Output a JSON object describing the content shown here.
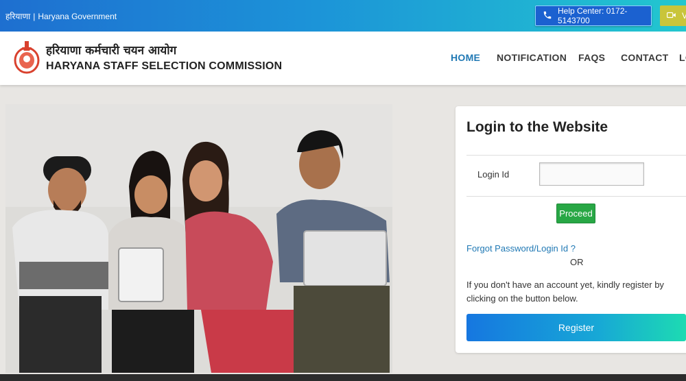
{
  "topbar": {
    "hindi_name": "हरियाणा",
    "separator": "|",
    "gov_label": "Haryana Government",
    "help_center": "Help Center: 0172-5143700",
    "video_label": "V"
  },
  "header": {
    "title_hindi": "हरियाणा कर्मचारी चयन आयोग",
    "title_english": "HARYANA STAFF SELECTION COMMISSION",
    "nav": [
      "HOME",
      "NOTIFICATION",
      "FAQS",
      "CONTACT",
      "LO"
    ],
    "active_nav": "HOME"
  },
  "login": {
    "heading": "Login to the Website",
    "login_id_label": "Login Id",
    "login_id_value": "",
    "proceed_label": "Proceed",
    "forgot_link": "Forgot Password/Login Id ?",
    "or_text": "OR",
    "register_info": "If you don't have an account yet, kindly register by clicking on the button below.",
    "register_label": "Register"
  },
  "colors": {
    "accent": "#1f78b4",
    "proceed": "#28a745",
    "topbar_start": "#1e6fd0",
    "topbar_end": "#22c7cf"
  },
  "icons": {
    "help": "phone-icon",
    "video": "video-camera-icon",
    "logo": "haryana-emblem-icon"
  }
}
